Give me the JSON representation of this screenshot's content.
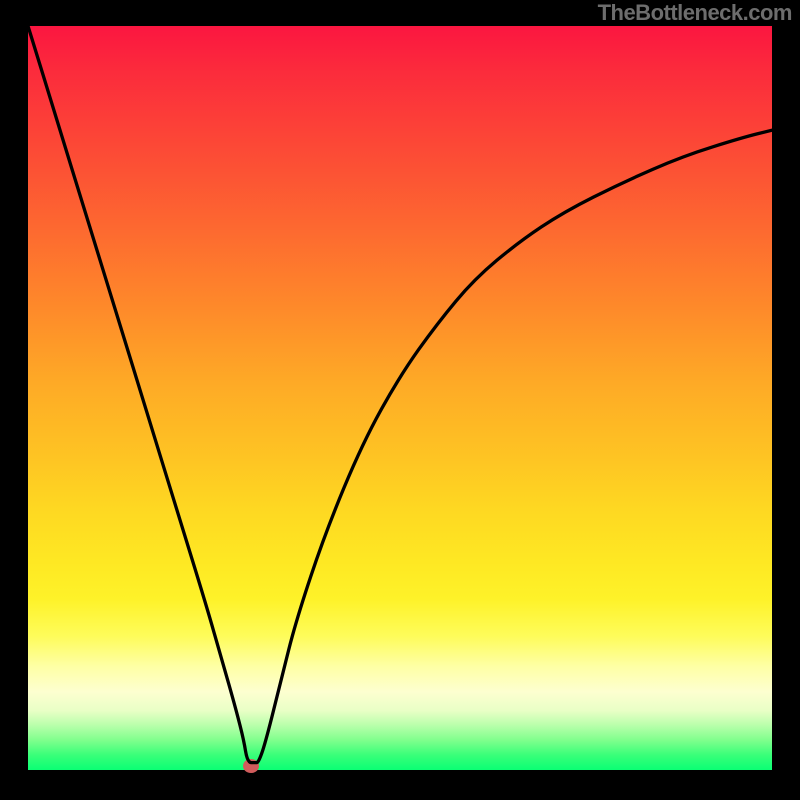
{
  "watermark": "TheBottleneck.com",
  "chart_data": {
    "type": "line",
    "title": "",
    "xlabel": "",
    "ylabel": "",
    "xlim": [
      0,
      100
    ],
    "ylim": [
      0,
      100
    ],
    "grid": false,
    "legend": false,
    "series": [
      {
        "name": "curve",
        "x": [
          0,
          4,
          8,
          12,
          16,
          20,
          24,
          26,
          28,
          29,
          29.5,
          30.5,
          31,
          32,
          34,
          36,
          40,
          45,
          50,
          55,
          60,
          66,
          72,
          80,
          88,
          96,
          100
        ],
        "y": [
          100,
          87,
          74,
          61,
          48,
          35,
          22,
          15,
          8,
          4,
          1,
          1,
          1,
          4,
          12,
          20,
          32,
          44,
          53,
          60,
          66,
          71,
          75,
          79,
          82.5,
          85,
          86
        ]
      }
    ],
    "marker": {
      "x": 30,
      "y": 0.5,
      "color": "#d15c5c"
    },
    "background_gradient": {
      "top": "#fb1640",
      "mid": "#fec423",
      "bottom": "#0aff74"
    }
  }
}
